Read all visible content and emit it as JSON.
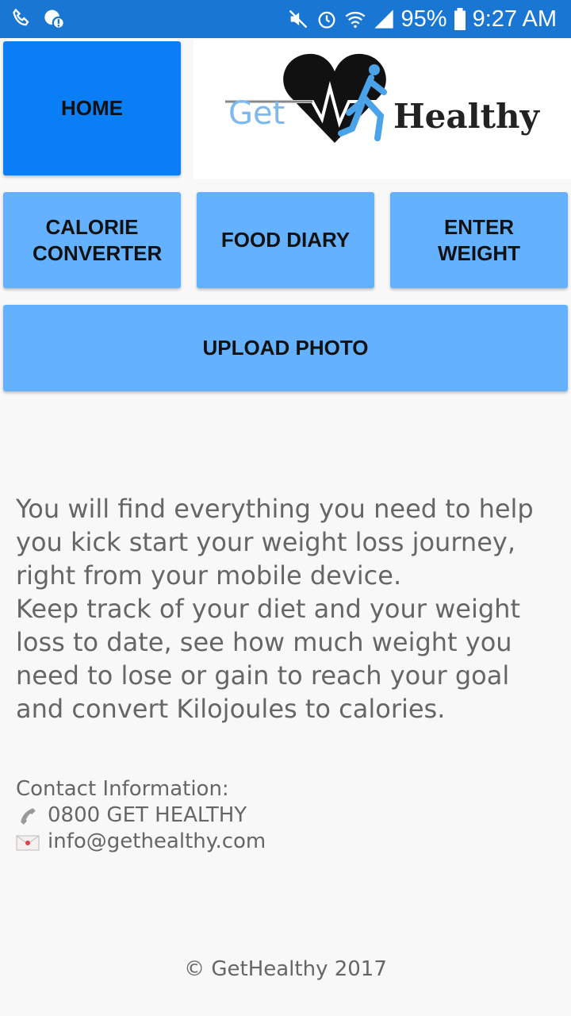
{
  "status_bar": {
    "battery_percent": "95%",
    "time": "9:27 AM",
    "left_icons": [
      "phone-signal-icon",
      "chat-alert-icon"
    ],
    "right_icons": [
      "mute-icon",
      "alarm-icon",
      "wifi-icon",
      "signal-icon",
      "battery-icon"
    ]
  },
  "nav": {
    "home": "HOME",
    "calorie_converter": "CALORIE CONVERTER",
    "food_diary": "FOOD DIARY",
    "enter_weight": "ENTER WEIGHT",
    "upload_photo": "UPLOAD PHOTO"
  },
  "logo": {
    "word1": "Get",
    "word2": "Healthy"
  },
  "intro": {
    "line1": "You will find everything you need to help you kick start your weight loss journey, right from your mobile device.",
    "line2": "Keep track of your diet and your weight loss to date, see how much weight you need to lose or gain to reach your goal and convert Kilojoules to calories."
  },
  "contact": {
    "heading": "Contact Information:",
    "phone": "0800 GET HEALTHY",
    "email": "info@gethealthy.com"
  },
  "footer": {
    "copyright": "© GetHealthy 2017"
  },
  "colors": {
    "status_bar": "#1976d2",
    "home_button": "#0a7ff5",
    "nav_button": "#64b2ff",
    "text": "#666666"
  }
}
